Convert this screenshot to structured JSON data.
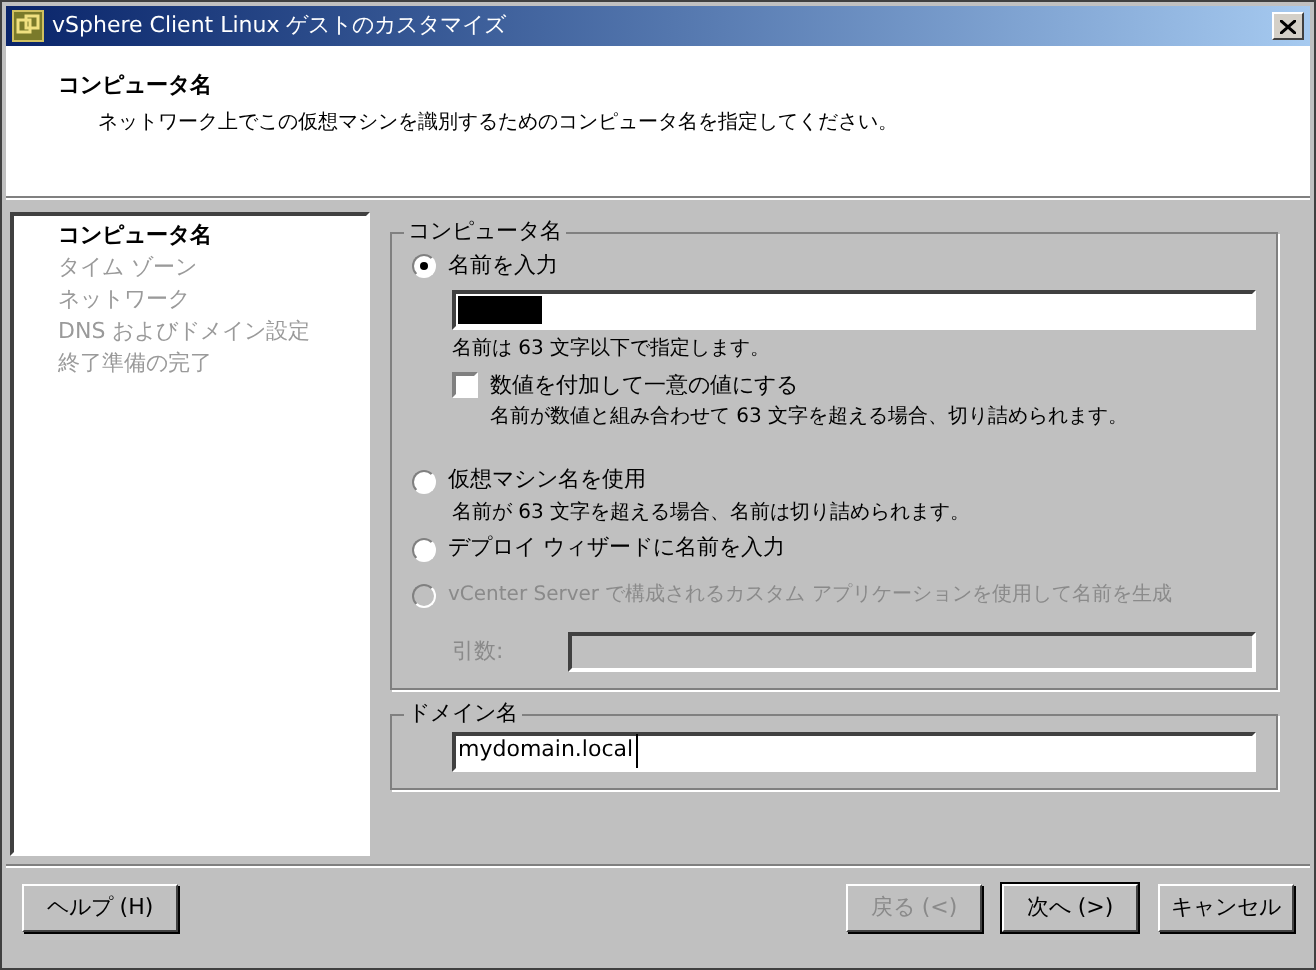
{
  "window": {
    "title": "vSphere Client Linux ゲストのカスタマイズ"
  },
  "header": {
    "title": "コンピュータ名",
    "subtitle": "ネットワーク上でこの仮想マシンを識別するためのコンピュータ名を指定してください。"
  },
  "steps": [
    {
      "label": "コンピュータ名",
      "selected": true
    },
    {
      "label": "タイム ゾーン",
      "selected": false
    },
    {
      "label": "ネットワーク",
      "selected": false
    },
    {
      "label": "DNS およびドメイン設定",
      "selected": false
    },
    {
      "label": "終了準備の完了",
      "selected": false
    }
  ],
  "computer_name": {
    "legend": "コンピュータ名",
    "options": [
      {
        "label": "名前を入力",
        "selected": true,
        "disabled": false,
        "name_field": {
          "redacted": true
        },
        "hint": "名前は 63 文字以下で指定します。",
        "checkbox": {
          "label": "数値を付加して一意の値にする",
          "checked": false,
          "note": "名前が数値と組み合わせて 63 文字を超える場合、切り詰められます。"
        }
      },
      {
        "label": "仮想マシン名を使用",
        "selected": false,
        "disabled": false,
        "note": "名前が 63 文字を超える場合、名前は切り詰められます。"
      },
      {
        "label": "デプロイ ウィザードに名前を入力",
        "selected": false,
        "disabled": false
      },
      {
        "label": "vCenter Server で構成されるカスタム アプリケーションを使用して名前を生成",
        "selected": false,
        "disabled": true,
        "argument": {
          "label": "引数:",
          "disabled": true
        }
      }
    ]
  },
  "domain": {
    "legend": "ドメイン名",
    "value": "mydomain.local"
  },
  "help_button": {
    "label": "ヘルプ (H)",
    "disabled": false
  },
  "nav_buttons": [
    {
      "label": "戻る (<)",
      "disabled": true
    },
    {
      "label": "次へ (>)",
      "disabled": false,
      "default": true
    },
    {
      "label": "キャンセル",
      "disabled": false,
      "default": false
    }
  ]
}
